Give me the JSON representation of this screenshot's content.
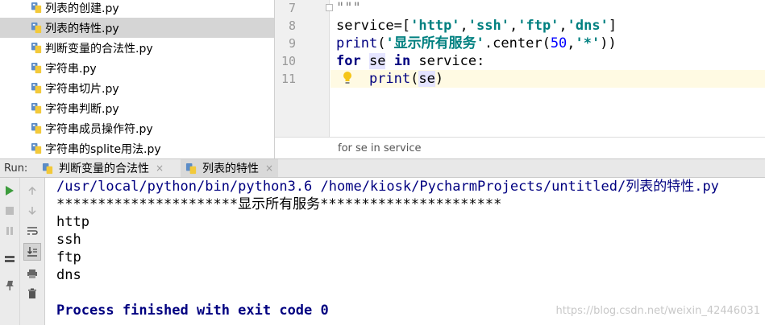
{
  "project_tree": {
    "files": [
      {
        "name": "列表的创建.py",
        "selected": false
      },
      {
        "name": "列表的特性.py",
        "selected": true
      },
      {
        "name": "判断变量的合法性.py",
        "selected": false
      },
      {
        "name": "字符串.py",
        "selected": false
      },
      {
        "name": "字符串切片.py",
        "selected": false
      },
      {
        "name": "字符串判断.py",
        "selected": false
      },
      {
        "name": "字符串成员操作符.py",
        "selected": false
      },
      {
        "name": "字符串的splite用法.py",
        "selected": false
      }
    ]
  },
  "editor": {
    "line_numbers": [
      "7",
      "8",
      "9",
      "10",
      "11"
    ],
    "code": {
      "l7": "\"\"\"",
      "l8_a": "service=[",
      "l8_s1": "'http'",
      "l8_c1": ",",
      "l8_s2": "'ssh'",
      "l8_c2": ",",
      "l8_s3": "'ftp'",
      "l8_c3": ",",
      "l8_s4": "'dns'",
      "l8_b": "]",
      "l9_print": "print",
      "l9_open": "(",
      "l9_str": "'显示所有服务'",
      "l9_mid": ".center(",
      "l9_num": "50",
      "l9_comma": ",",
      "l9_star": "'*'",
      "l9_close": "))",
      "l10_for": "for",
      "l10_sp1": " ",
      "l10_se": "se",
      "l10_sp2": " ",
      "l10_in": "in",
      "l10_rest": " service:",
      "l11_indent": "    ",
      "l11_print": "print",
      "l11_open": "(",
      "l11_se": "se",
      "l11_close": ")"
    },
    "breadcrumb": "for se in service"
  },
  "run_panel": {
    "title": "Run:",
    "tabs": [
      {
        "label": "判断变量的合法性",
        "active": false,
        "close": "×"
      },
      {
        "label": "列表的特性",
        "active": true,
        "close": "×"
      }
    ],
    "console": {
      "command": "/usr/local/python/bin/python3.6 /home/kiosk/PycharmProjects/untitled/列表的特性.py",
      "lines": [
        "**********************显示所有服务**********************",
        "http",
        "ssh",
        "ftp",
        "dns"
      ],
      "exit": "Process finished with exit code 0"
    },
    "watermark": "https://blog.csdn.net/weixin_42446031"
  },
  "icons": {
    "python_file": "python-file-icon",
    "bulb": "intention-bulb-icon",
    "rerun": "rerun-icon",
    "stop": "stop-icon",
    "pause": "pause-icon",
    "layout": "restore-layout-icon",
    "pin": "pin-icon",
    "up": "up-arrow-icon",
    "down": "down-arrow-icon",
    "wrap": "soft-wrap-icon",
    "scroll_end": "scroll-to-end-icon",
    "print": "print-icon",
    "trash": "clear-all-icon"
  },
  "colors": {
    "keyword": "#000080",
    "string": "#008080",
    "number": "#0000ff",
    "selection": "#d5d5d5",
    "caret_line": "#fffae3",
    "run_green": "#3c9c3c"
  }
}
